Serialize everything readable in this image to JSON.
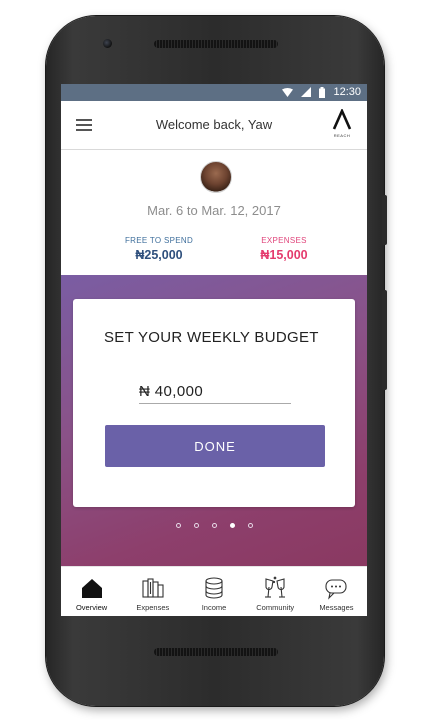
{
  "status_bar": {
    "time": "12:30"
  },
  "app_bar": {
    "title": "Welcome back, Yaw",
    "logo_text": "REACH"
  },
  "overview": {
    "date_range": "Mar. 6 to Mar. 12, 2017",
    "free_to_spend": {
      "label": "FREE TO SPEND",
      "value": "₦25,000"
    },
    "expenses": {
      "label": "EXPENSES",
      "value": "₦15,000"
    }
  },
  "budget_card": {
    "title": "SET YOUR WEEKLY BUDGET",
    "amount": "₦ 40,000",
    "done_label": "DONE"
  },
  "pager": {
    "count": 5,
    "active_index": 3
  },
  "bottom_nav": {
    "items": [
      {
        "label": "Overview",
        "icon": "home-icon"
      },
      {
        "label": "Expenses",
        "icon": "expenses-icon"
      },
      {
        "label": "Income",
        "icon": "coins-icon"
      },
      {
        "label": "Community",
        "icon": "glasses-icon"
      },
      {
        "label": "Messages",
        "icon": "chat-icon"
      }
    ]
  },
  "colors": {
    "status_bar": "#5d6f84",
    "accent_button": "#6a61a8",
    "free_to_spend": "#2e4f7c",
    "expenses": "#e43b6d"
  }
}
